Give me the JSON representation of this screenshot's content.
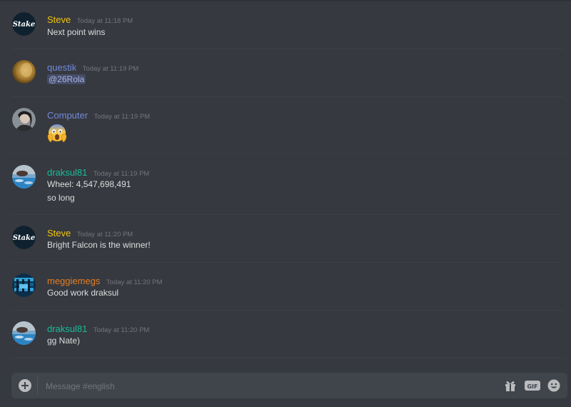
{
  "channel": {
    "name": "english"
  },
  "messages": [
    {
      "author": "Steve",
      "author_color": "#f1c40f",
      "avatar": "stake-logo",
      "timestamp": "Today at 11:18 PM",
      "lines": [
        "Next point wins"
      ]
    },
    {
      "author": "questik",
      "author_color": "#7289da",
      "avatar": "gold-avatar",
      "timestamp": "Today at 11:19 PM",
      "mention": "@26Rola"
    },
    {
      "author": "Computer",
      "author_color": "#7289da",
      "avatar": "portrait-avatar",
      "timestamp": "Today at 11:19 PM",
      "emoji": "face-screaming-in-fear"
    },
    {
      "author": "draksul81",
      "author_color": "#1abc9c",
      "avatar": "water-avatar",
      "timestamp": "Today at 11:19 PM",
      "lines": [
        "Wheel: 4,547,698,491",
        "so long"
      ]
    },
    {
      "author": "Steve",
      "author_color": "#f1c40f",
      "avatar": "stake-logo",
      "timestamp": "Today at 11:20 PM",
      "lines": [
        "Bright Falcon is the winner!"
      ]
    },
    {
      "author": "meggiemegs",
      "author_color": "#e67e22",
      "avatar": "blue-pattern-avatar",
      "timestamp": "Today at 11:20 PM",
      "lines": [
        "Good work draksul"
      ]
    },
    {
      "author": "draksul81",
      "author_color": "#1abc9c",
      "avatar": "water-avatar",
      "timestamp": "Today at 11:20 PM",
      "lines": [
        "gg Nate)"
      ]
    }
  ],
  "composer": {
    "placeholder": "Message #english",
    "gif_label": "GIF"
  },
  "icons": {
    "add": "plus-circle-icon",
    "gift": "gift-icon",
    "gif": "gif-icon",
    "emoji": "emoji-icon"
  },
  "logo_text": "Stake"
}
